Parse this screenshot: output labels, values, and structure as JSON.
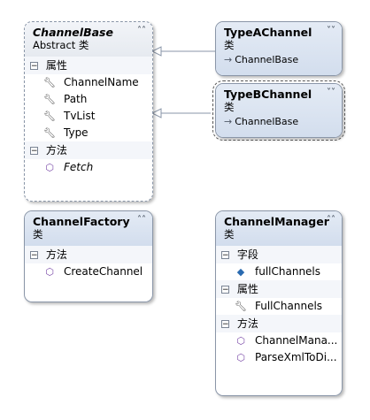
{
  "channel_base": {
    "title": "ChannelBase",
    "subtitle": "Abstract 类",
    "sections": [
      {
        "label": "属性",
        "members": [
          "ChannelName",
          "Path",
          "TvList",
          "Type"
        ]
      },
      {
        "label": "方法",
        "members": [
          "Fetch"
        ]
      }
    ]
  },
  "type_a_channel": {
    "title": "TypeAChannel",
    "subtitle": "类",
    "inherits": "ChannelBase"
  },
  "type_b_channel": {
    "title": "TypeBChannel",
    "subtitle": "类",
    "inherits": "ChannelBase"
  },
  "channel_factory": {
    "title": "ChannelFactory",
    "subtitle": "类",
    "sections": [
      {
        "label": "方法",
        "members": [
          "CreateChannel"
        ]
      }
    ]
  },
  "channel_manager": {
    "title": "ChannelManager",
    "subtitle": "类",
    "sections": [
      {
        "label": "字段",
        "members": [
          "fullChannels"
        ]
      },
      {
        "label": "属性",
        "members": [
          "FullChannels"
        ]
      },
      {
        "label": "方法",
        "members": [
          "ChannelMana...",
          "ParseXmlToDi..."
        ]
      }
    ]
  },
  "icons": {
    "collapse": "chevron-up-icon",
    "expand": "chevron-down-icon",
    "property": "wrench-icon",
    "method": "method-cube-icon",
    "field": "field-icon",
    "inheritance": "inheritance-arrow-icon"
  }
}
